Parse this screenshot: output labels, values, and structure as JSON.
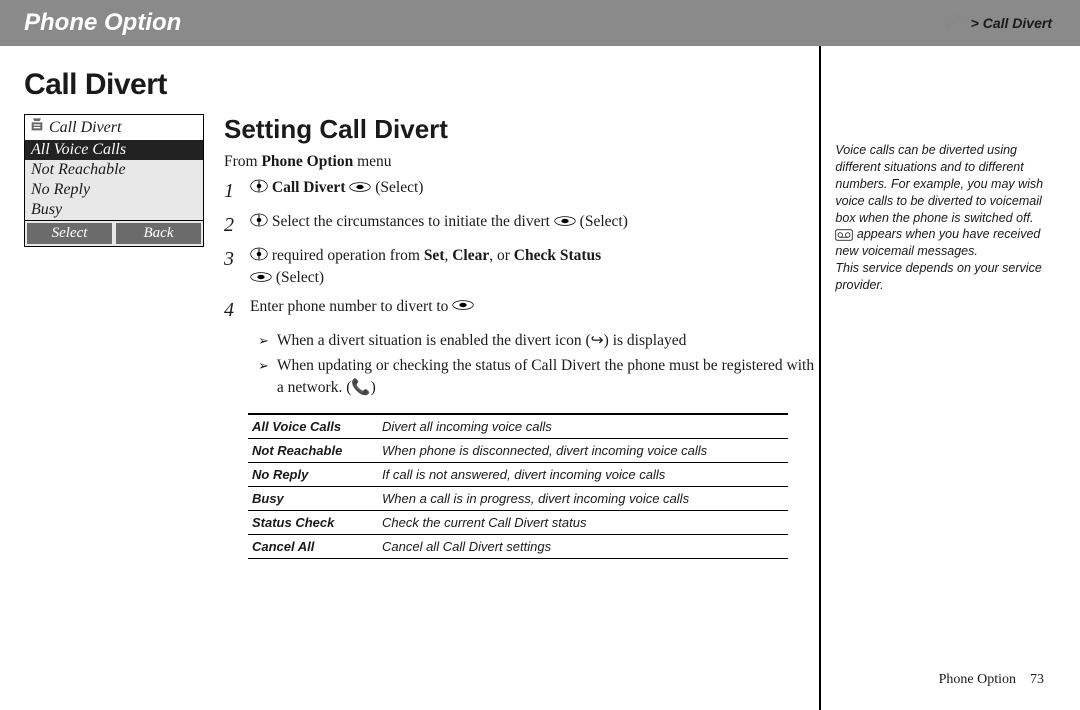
{
  "header": {
    "section": "Phone Option",
    "breadcrumb": "> Call Divert"
  },
  "page": {
    "title": "Call Divert",
    "subtitle": "Setting Call Divert",
    "from_line_prefix": "From ",
    "from_line_bold": "Phone Option",
    "from_line_suffix": " menu"
  },
  "phone": {
    "title": "Call Divert",
    "rows": [
      "All Voice Calls",
      "Not Reachable",
      "No Reply",
      "Busy"
    ],
    "soft_left": "Select",
    "soft_right": "Back"
  },
  "steps": [
    {
      "num": "1",
      "pre_nav": true,
      "bold1": "Call Divert",
      "post_act": true,
      "tail": " (Select)"
    },
    {
      "num": "2",
      "pre_nav": true,
      "text": "Select the circumstances to initiate the divert ",
      "post_act": true,
      "tail": " (Select)"
    },
    {
      "num": "3",
      "pre_nav": true,
      "text": "required operation from ",
      "bold1": "Set",
      "sep1": ", ",
      "bold2": "Clear",
      "sep2": ", or ",
      "bold3": "Check Status",
      "line2_act": true,
      "line2_tail": " (Select)"
    },
    {
      "num": "4",
      "text": "Enter phone number to divert to ",
      "post_act": true
    }
  ],
  "bullets": [
    "When a divert situation is enabled the divert icon (↪) is displayed",
    "When updating or checking the status of Call Divert the phone must be registered with a network. (📞)"
  ],
  "table": [
    {
      "k": "All Voice Calls",
      "v": "Divert all incoming voice calls"
    },
    {
      "k": "Not Reachable",
      "v": "When phone is disconnected, divert incoming voice calls"
    },
    {
      "k": "No Reply",
      "v": "If call is not answered, divert incoming voice calls"
    },
    {
      "k": "Busy",
      "v": "When a call is in progress, divert incoming voice calls"
    },
    {
      "k": "Status Check",
      "v": "Check the current Call Divert status"
    },
    {
      "k": "Cancel All",
      "v": "Cancel all Call Divert settings"
    }
  ],
  "sidebar": {
    "p1": "Voice calls can be diverted using different situations and to different numbers. For example, you may wish voice calls to be diverted to voicemail box when the phone is switched off.",
    "p2a": " appears when you have received new voicemail messages.",
    "p3": "This service depends on your service provider."
  },
  "footer": {
    "label": "Phone Option",
    "page": "73"
  }
}
